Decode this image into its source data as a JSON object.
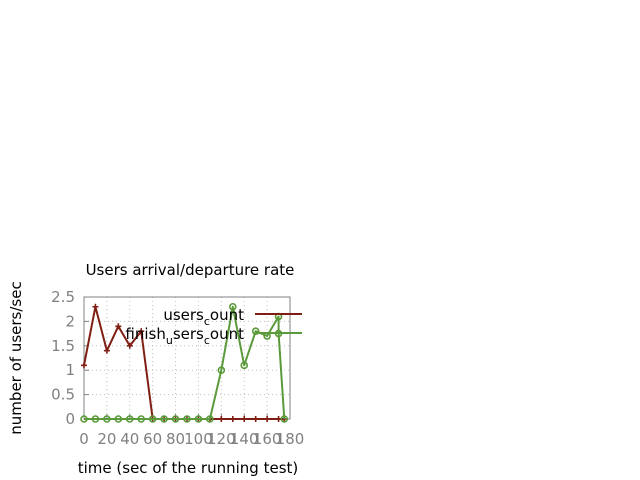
{
  "chart_data": {
    "type": "line",
    "title": "Users arrival/departure rate",
    "xlabel": "time (sec of the running test)",
    "ylabel": "number of users/sec",
    "xlim": [
      0,
      180
    ],
    "ylim": [
      0,
      2.5
    ],
    "x_ticks": [
      0,
      20,
      40,
      60,
      80,
      100,
      120,
      140,
      160,
      180
    ],
    "y_ticks": [
      0,
      0.5,
      1,
      1.5,
      2,
      2.5
    ],
    "x_tick_labels": [
      "0",
      "20",
      "40",
      "60",
      "80",
      "100",
      "120",
      "140",
      "160",
      "180"
    ],
    "y_tick_labels": [
      "0",
      "0.5",
      "1",
      "1.5",
      "2",
      "2.5"
    ],
    "grid": true,
    "legend_position": "top-right",
    "series": [
      {
        "legend_main": "users",
        "legend_sub": "c",
        "legend_tail": "ount",
        "color": "#7f1f14",
        "marker": "plus",
        "x": [
          0,
          10,
          20,
          30,
          40,
          50,
          60,
          70,
          80,
          90,
          100,
          110,
          120,
          130,
          140,
          150,
          160,
          170,
          175
        ],
        "y": [
          1.1,
          2.3,
          1.4,
          1.9,
          1.5,
          1.8,
          0,
          0,
          0,
          0,
          0,
          0,
          0,
          0,
          0,
          0,
          0,
          0,
          0
        ]
      },
      {
        "legend_main": "finish",
        "legend_sub": "u",
        "legend_tail": "sers",
        "legend_sub2": "c",
        "legend_tail2": "ount",
        "color": "#5a9a3a",
        "marker": "circle",
        "x": [
          0,
          10,
          20,
          30,
          40,
          50,
          60,
          70,
          80,
          90,
          100,
          110,
          120,
          130,
          140,
          150,
          160,
          170,
          170,
          175
        ],
        "y": [
          0,
          0,
          0,
          0,
          0,
          0,
          0,
          0,
          0,
          0,
          0,
          0,
          1.0,
          2.3,
          1.1,
          1.8,
          1.7,
          2.1,
          1.75,
          0
        ]
      }
    ]
  }
}
